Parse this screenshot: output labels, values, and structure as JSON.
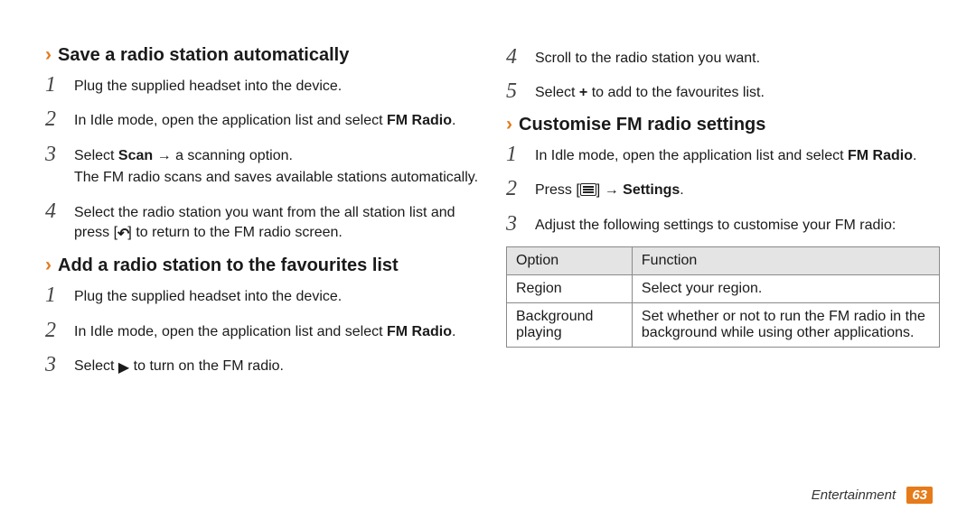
{
  "left": {
    "section_a": {
      "chevron": "›",
      "title": "Save a radio station automatically",
      "steps": [
        {
          "line1": "Plug the supplied headset into the device."
        },
        {
          "line1_pre": "In Idle mode, open the application list and select ",
          "line1_bold": "FM Radio",
          "line1_post": "."
        },
        {
          "line1_pre": "Select ",
          "line1_bold": "Scan",
          "line1_post": " → a scanning option.",
          "aux": "The FM radio scans and saves available stations automatically."
        },
        {
          "line1_pre": "Select the radio station you want from the all station list and press [",
          "line1_icon": "back",
          "line1_post": "] to return to the FM radio screen."
        }
      ]
    },
    "section_b": {
      "chevron": "›",
      "title": "Add a radio station to the favourites list",
      "steps": [
        {
          "line1": "Plug the supplied headset into the device."
        },
        {
          "line1_pre": "In Idle mode, open the application list and select ",
          "line1_bold": "FM Radio",
          "line1_post": "."
        },
        {
          "line1_pre": "Select ",
          "line1_icon": "play",
          "line1_post": " to turn on the FM radio."
        }
      ]
    }
  },
  "right": {
    "top_steps_start": 4,
    "top_steps": [
      {
        "line1": "Scroll to the radio station you want."
      },
      {
        "line1_pre": "Select ",
        "line1_bold": "+",
        "line1_post": " to add to the favourites list."
      }
    ],
    "section_c": {
      "chevron": "›",
      "title": "Customise FM radio settings",
      "steps": [
        {
          "line1_pre": "In Idle mode, open the application list and select ",
          "line1_bold": "FM Radio",
          "line1_post": "."
        },
        {
          "line1_pre": "Press [",
          "line1_icon": "menu",
          "line1_mid": "] → ",
          "line1_bold": "Settings",
          "line1_post": "."
        },
        {
          "line1": "Adjust the following settings to customise your FM radio:"
        }
      ]
    },
    "table": {
      "head": {
        "c1": "Option",
        "c2": "Function"
      },
      "rows": [
        {
          "c1": "Region",
          "c2": "Select your region."
        },
        {
          "c1": "Background playing",
          "c2": "Set whether or not to run the FM radio in the background while using other applications."
        }
      ]
    }
  },
  "footer": {
    "section": "Entertainment",
    "page": "63"
  }
}
